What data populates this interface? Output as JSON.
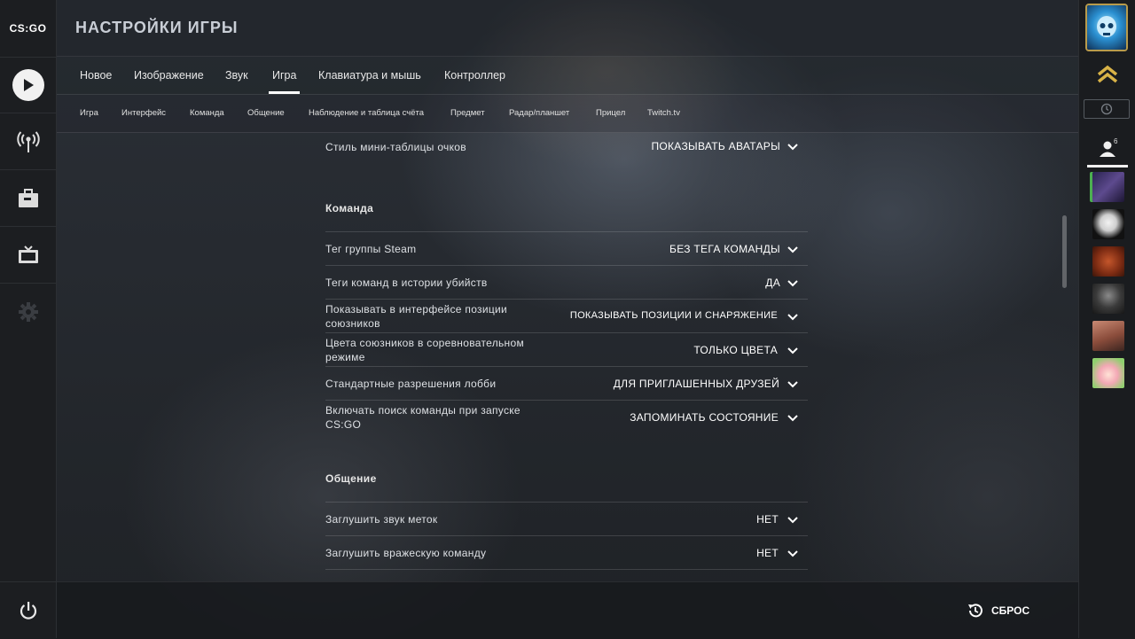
{
  "app": {
    "logo_text": "CS:GO"
  },
  "header": {
    "title": "НАСТРОЙКИ ИГРЫ"
  },
  "tabs": [
    {
      "label": "Новое"
    },
    {
      "label": "Изображение"
    },
    {
      "label": "Звук"
    },
    {
      "label": "Игра",
      "active": true
    },
    {
      "label": "Клавиатура и мышь"
    },
    {
      "label": "Контроллер"
    }
  ],
  "subtabs": [
    {
      "label": "Игра"
    },
    {
      "label": "Интерфейс"
    },
    {
      "label": "Команда"
    },
    {
      "label": "Общение"
    },
    {
      "label": "Наблюдение и таблица счёта"
    },
    {
      "label": "Предмет"
    },
    {
      "label": "Радар/планшет"
    },
    {
      "label": "Прицел"
    },
    {
      "label": "Twitch.tv"
    }
  ],
  "settings": {
    "top_row": {
      "label": "Стиль мини-таблицы очков",
      "value": "ПОКАЗЫВАТЬ АВАТАРЫ"
    },
    "team_section": "Команда",
    "team_rows": [
      {
        "label_1": "Тег группы Steam",
        "label_2": "",
        "value": "БЕЗ ТЕГА КОМАНДЫ"
      },
      {
        "label_1": "Теги команд в истории убийств",
        "label_2": "",
        "value": "ДА"
      },
      {
        "label_1": "Показывать в интерфейсе позиции",
        "label_2": "союзников",
        "value": "ПОКАЗЫВАТЬ ПОЗИЦИИ И СНАРЯЖЕНИЕ"
      },
      {
        "label_1": "Цвета союзников в соревновательном",
        "label_2": "режиме",
        "value": "ТОЛЬКО ЦВЕТА"
      },
      {
        "label_1": "Стандартные разрешения лобби",
        "label_2": "",
        "value": "ДЛЯ ПРИГЛАШЕННЫХ ДРУЗЕЙ"
      },
      {
        "label_1": "Включать поиск команды при запуске",
        "label_2": "CS:GO",
        "value": "ЗАПОМИНАТЬ СОСТОЯНИЕ"
      }
    ],
    "comm_section": "Общение",
    "comm_rows": [
      {
        "label": "Заглушить звук меток",
        "value": "НЕТ"
      },
      {
        "label": "Заглушить вражескую команду",
        "value": "НЕТ"
      }
    ]
  },
  "footer": {
    "reset_label": "СБРОС"
  },
  "right_panel": {
    "friends_count": "6"
  },
  "colors": {
    "accent": "#ffffff",
    "bg": "#1b1d20",
    "rank_gold": "#d9b347"
  }
}
